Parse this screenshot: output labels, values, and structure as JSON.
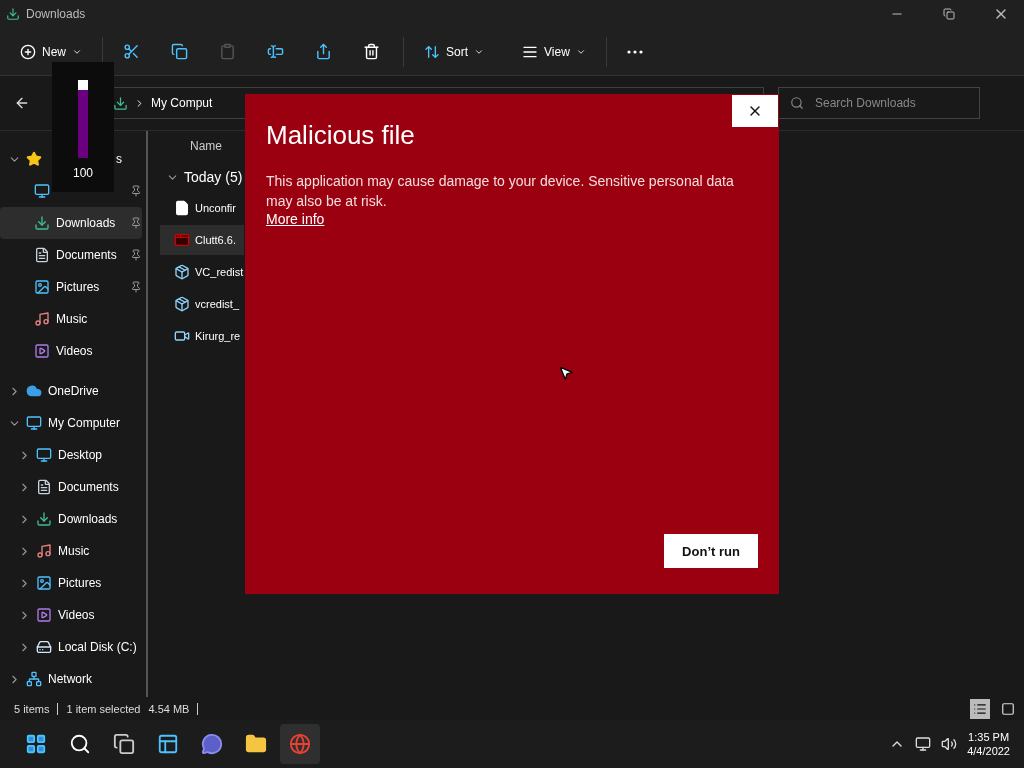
{
  "window": {
    "title": "Downloads"
  },
  "toolbar": {
    "new_label": "New",
    "sort_label": "Sort",
    "view_label": "View",
    "paste_disabled": true
  },
  "address": {
    "path": "My Comput"
  },
  "search": {
    "placeholder": "Search Downloads"
  },
  "sidebar": {
    "items": [
      {
        "kind": "star",
        "label": "s",
        "expanded": true,
        "selected": false,
        "children": [
          {
            "kind": "desktop",
            "pinned": true,
            "selected": false
          },
          {
            "kind": "downloads",
            "label": "Downloads",
            "pinned": true,
            "selected": true
          },
          {
            "kind": "documents",
            "label": "Documents",
            "pinned": true,
            "selected": false
          },
          {
            "kind": "pictures",
            "label": "Pictures",
            "pinned": true,
            "selected": false
          },
          {
            "kind": "music",
            "label": "Music",
            "pinned": false,
            "selected": false
          },
          {
            "kind": "videos",
            "label": "Videos",
            "pinned": false,
            "selected": false
          }
        ]
      },
      {
        "kind": "cloud",
        "label": "OneDrive",
        "expanded": false,
        "selected": false
      },
      {
        "kind": "computer",
        "label": "My Computer",
        "expanded": true,
        "selected": false,
        "children": [
          {
            "kind": "desktop",
            "label": "Desktop",
            "expanded": false,
            "selected": false
          },
          {
            "kind": "documents",
            "label": "Documents",
            "expanded": false,
            "selected": false
          },
          {
            "kind": "downloads",
            "label": "Downloads",
            "expanded": false,
            "selected": false
          },
          {
            "kind": "music",
            "label": "Music",
            "expanded": false,
            "selected": false
          },
          {
            "kind": "pictures",
            "label": "Pictures",
            "expanded": false,
            "selected": false
          },
          {
            "kind": "videos",
            "label": "Videos",
            "expanded": false,
            "selected": false
          },
          {
            "kind": "disk",
            "label": "Local Disk (C:)",
            "expanded": false,
            "selected": false
          }
        ]
      },
      {
        "kind": "network",
        "label": "Network",
        "expanded": false,
        "selected": false
      }
    ]
  },
  "file_list": {
    "column": "Name",
    "groups": [
      {
        "label": "Today (5)",
        "expanded": true,
        "files": [
          {
            "kind": "document",
            "name": "Unconfir",
            "selected": false
          },
          {
            "kind": "app",
            "name": "Clutt6.6.",
            "selected": true
          },
          {
            "kind": "installer",
            "name": "VC_redist",
            "selected": false
          },
          {
            "kind": "installer",
            "name": "vcredist_",
            "selected": false
          },
          {
            "kind": "video",
            "name": "Kirurg_re",
            "selected": false
          }
        ]
      }
    ]
  },
  "status_bar": {
    "count": "5 items",
    "selection": "1 item selected",
    "size": "4.54 MB",
    "views": [
      {
        "kind": "details",
        "selected": true
      },
      {
        "kind": "tiles",
        "selected": false
      }
    ]
  },
  "volume_overlay": {
    "level": 1,
    "reading": "100"
  },
  "dialog": {
    "title": "Malicious file",
    "message": "This application may cause damage to your device. Sensitive personal data may also be at risk.",
    "link": "More info",
    "button": "Don’t run"
  },
  "taskbar": {
    "apps": [
      {
        "kind": "start",
        "selected": false
      },
      {
        "kind": "search",
        "selected": false
      },
      {
        "kind": "taskview",
        "selected": false
      },
      {
        "kind": "widgets",
        "selected": false
      },
      {
        "kind": "chat",
        "selected": false
      },
      {
        "kind": "explorer",
        "selected": false
      },
      {
        "kind": "browser",
        "selected": true
      }
    ],
    "time": "1:35 PM",
    "date": "4/4/2022"
  }
}
